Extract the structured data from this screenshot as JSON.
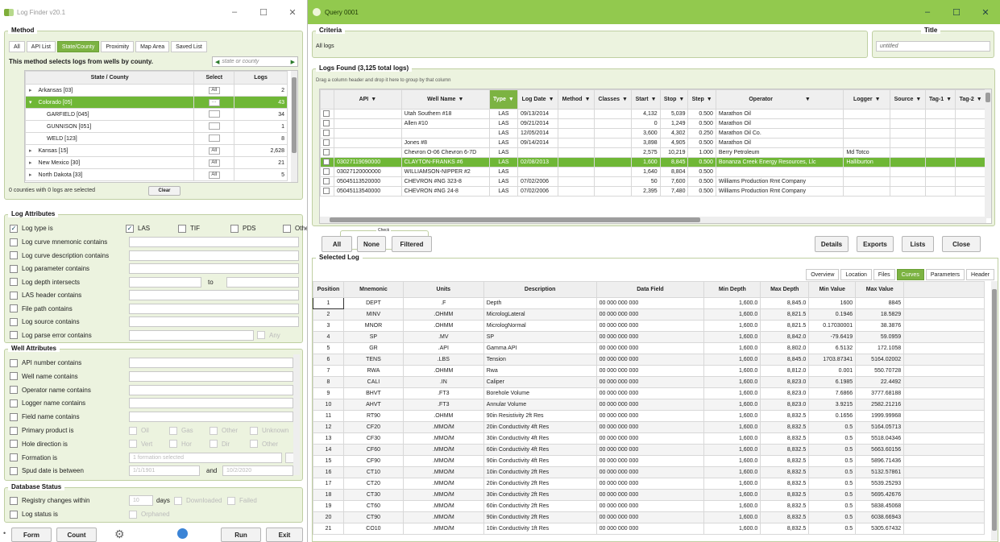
{
  "left": {
    "title": "Log Finder v20.1",
    "method": {
      "header": "Method",
      "tabs": [
        "All",
        "API List",
        "State/County",
        "Proximity",
        "Map Area",
        "Saved List"
      ],
      "desc": "This method selects logs from wells by county.",
      "search_placeholder": "state or county",
      "cols": [
        "State / County",
        "Select",
        "Logs"
      ],
      "rows": [
        {
          "name": "Arkansas  [03]",
          "sel": "All",
          "logs": "2",
          "arrow": "▸"
        },
        {
          "name": "Colorado  [05]",
          "sel": "···",
          "logs": "43",
          "arrow": "▾"
        },
        {
          "name": "GARFIELD  [045]",
          "sel": "",
          "logs": "34",
          "arrow": ""
        },
        {
          "name": "GUNNISON  [051]",
          "sel": "",
          "logs": "1",
          "arrow": ""
        },
        {
          "name": "WELD  [123]",
          "sel": "",
          "logs": "8",
          "arrow": ""
        },
        {
          "name": "Kansas  [15]",
          "sel": "All",
          "logs": "2,628",
          "arrow": "▸"
        },
        {
          "name": "New Mexico  [30]",
          "sel": "All",
          "logs": "21",
          "arrow": "▸"
        },
        {
          "name": "North Dakota  [33]",
          "sel": "All",
          "logs": "5",
          "arrow": "▸"
        }
      ],
      "status": "0 counties with 0 logs are selected",
      "clear": "Clear"
    },
    "logattr": {
      "header": "Log Attributes",
      "type_label": "Log type is",
      "types": [
        "LAS",
        "TIF",
        "PDS",
        "Other"
      ],
      "rows": [
        "Log curve mnemonic contains",
        "Log curve description contains",
        "Log parameter contains",
        "Log depth intersects",
        "LAS header contains",
        "File path contains",
        "Log source contains",
        "Log parse error contains"
      ],
      "to": "to",
      "any": "Any"
    },
    "wellattr": {
      "header": "Well Attributes",
      "rows": [
        "API number contains",
        "Well name contains",
        "Operator name contains",
        "Logger name contains",
        "Field name contains",
        "Primary product is",
        "Hole direction is",
        "Formation is",
        "Spud date is between"
      ],
      "product": [
        "Oil",
        "Gas",
        "Other",
        "Unknown"
      ],
      "direction": [
        "Vert",
        "Hor",
        "Dir",
        "Other"
      ],
      "formation": "1 formation selected",
      "date1": "1/1/1901",
      "and": "and",
      "date2": "10/2/2020"
    },
    "db": {
      "header": "Database Status",
      "rows": [
        "Registry changes within",
        "Log status is"
      ],
      "days_val": "10",
      "days": "days",
      "opt1": "Downloaded",
      "opt2": "Failed",
      "opt3": "Orphaned"
    },
    "footer": {
      "form": "Form",
      "count": "Count",
      "run": "Run",
      "exit": "Exit"
    }
  },
  "right": {
    "title": "Query 0001",
    "criteria_h": "Criteria",
    "criteria": "All logs",
    "title_h": "Title",
    "title_val": "untitled",
    "logs_h": "Logs Found  (3,125 total logs)",
    "drag": "Drag a column header and drop it here to group by that column",
    "cols": [
      "",
      "API",
      "Well Name",
      "Type",
      "Log Date",
      "Method",
      "Classes",
      "Start",
      "Stop",
      "Step",
      "Operator",
      "Logger",
      "Source",
      "Tag-1",
      "Tag-2"
    ],
    "rows": [
      [
        "",
        "",
        "Utah Southern #18",
        "LAS",
        "09/13/2014",
        "",
        "",
        "4,132",
        "5,039",
        "0.500",
        "Marathon Oil",
        "",
        "",
        "",
        ""
      ],
      [
        "",
        "",
        "Allen #10",
        "LAS",
        "09/21/2014",
        "",
        "",
        "0",
        "1,249",
        "0.500",
        "Marathon Oil",
        "",
        "",
        "",
        ""
      ],
      [
        "",
        "",
        "",
        "LAS",
        "12/05/2014",
        "",
        "",
        "3,600",
        "4,302",
        "0.250",
        "Marathon Oil Co.",
        "",
        "",
        "",
        ""
      ],
      [
        "",
        "",
        "Jones #8",
        "LAS",
        "09/14/2014",
        "",
        "",
        "3,898",
        "4,905",
        "0.500",
        "Marathon Oil",
        "",
        "",
        "",
        ""
      ],
      [
        "",
        "",
        "Chevron O-06 Chevron 6-7D",
        "LAS",
        "",
        "",
        "",
        "2,575",
        "10,219",
        "1.000",
        "Berry Petroleum",
        "Md Totco",
        "",
        "",
        ""
      ],
      [
        "",
        "03027119090000",
        "CLAYTON-FRANKS #6",
        "LAS",
        "02/08/2013",
        "",
        "",
        "1,600",
        "8,845",
        "0.500",
        "Bonanza Creek Energy Resources, Llc",
        "Halliburton",
        "",
        "",
        ""
      ],
      [
        "",
        "03027120000000",
        "WILLIAMSON-NIPPER #2",
        "LAS",
        "",
        "",
        "",
        "1,640",
        "8,804",
        "0.500",
        "",
        "",
        "",
        "",
        ""
      ],
      [
        "",
        "05045113520000",
        "CHEVRON #NG 323-8",
        "LAS",
        "07/02/2006",
        "",
        "",
        "50",
        "7,600",
        "0.500",
        "Williams Production Rmt Company",
        "",
        "",
        "",
        ""
      ],
      [
        "",
        "05045113540000",
        "CHEVRON #NG 24-8",
        "LAS",
        "07/02/2006",
        "",
        "",
        "2,395",
        "7,480",
        "0.500",
        "Williams Production Rmt Company",
        "",
        "",
        "",
        ""
      ]
    ],
    "sel_row": 5,
    "check_h": "Check",
    "b_all": "All",
    "b_none": "None",
    "b_filtered": "Filtered",
    "b_details": "Details",
    "b_exports": "Exports",
    "b_lists": "Lists",
    "b_close": "Close",
    "sel_h": "Selected Log",
    "tabs": [
      "Overview",
      "Location",
      "Files",
      "Curves",
      "Parameters",
      "Header"
    ],
    "ccols": [
      "Position",
      "Mnemonic",
      "Units",
      "Description",
      "Data Field",
      "Min Depth",
      "Max Depth",
      "Min Value",
      "Max Value"
    ],
    "curves": [
      [
        "1",
        "DEPT",
        ".F",
        "Depth",
        "00 000 000 000",
        "1,600.0",
        "8,845.0",
        "1600",
        "8845"
      ],
      [
        "2",
        "MINV",
        ".OHMM",
        "MicrologLateral",
        "00 000 000 000",
        "1,600.0",
        "8,821.5",
        "0.1946",
        "18.5829"
      ],
      [
        "3",
        "MNOR",
        ".OHMM",
        "MicrologNormal",
        "00 000 000 000",
        "1,600.0",
        "8,821.5",
        "0.17030001",
        "38.3876"
      ],
      [
        "4",
        "SP",
        ".MV",
        "SP",
        "00 000 000 000",
        "1,600.0",
        "8,842.0",
        "-79.6419",
        "59.0959"
      ],
      [
        "5",
        "GR",
        ".API",
        "Gamma API",
        "00 000 000 000",
        "1,600.0",
        "8,802.0",
        "6.5132",
        "172.1058"
      ],
      [
        "6",
        "TENS",
        ".LBS",
        "Tension",
        "00 000 000 000",
        "1,600.0",
        "8,845.0",
        "1703.87341",
        "5164.02002"
      ],
      [
        "7",
        "RWA",
        ".OHMM",
        "Rwa",
        "00 000 000 000",
        "1,600.0",
        "8,812.0",
        "0.001",
        "550.70728"
      ],
      [
        "8",
        "CALI",
        ".IN",
        "Caliper",
        "00 000 000 000",
        "1,600.0",
        "8,823.0",
        "6.1985",
        "22.4492"
      ],
      [
        "9",
        "BHVT",
        ".FT3",
        "Borehole Volume",
        "00 000 000 000",
        "1,600.0",
        "8,823.0",
        "7.6866",
        "3777.68188"
      ],
      [
        "10",
        "AHVT",
        ".FT3",
        "Annular Volume",
        "00 000 000 000",
        "1,600.0",
        "8,823.0",
        "3.9215",
        "2582.21216"
      ],
      [
        "11",
        "RT90",
        ".OHMM",
        "90in Resistivity 2ft Res",
        "00 000 000 000",
        "1,600.0",
        "8,832.5",
        "0.1656",
        "1999.99968"
      ],
      [
        "12",
        "CF20",
        ".MMO/M",
        "20in Conductivity 4ft Res",
        "00 000 000 000",
        "1,600.0",
        "8,832.5",
        "0.5",
        "5164.05713"
      ],
      [
        "13",
        "CF30",
        ".MMO/M",
        "30in Conductivity 4ft Res",
        "00 000 000 000",
        "1,600.0",
        "8,832.5",
        "0.5",
        "5518.04346"
      ],
      [
        "14",
        "CF60",
        ".MMO/M",
        "60in Conductivity 4ft Res",
        "00 000 000 000",
        "1,600.0",
        "8,832.5",
        "0.5",
        "5663.60156"
      ],
      [
        "15",
        "CF90",
        ".MMO/M",
        "90in Conductivity 4ft Res",
        "00 000 000 000",
        "1,600.0",
        "8,832.5",
        "0.5",
        "5896.71436"
      ],
      [
        "16",
        "CT10",
        ".MMO/M",
        "10in Conductivity 2ft Res",
        "00 000 000 000",
        "1,600.0",
        "8,832.5",
        "0.5",
        "5132.57861"
      ],
      [
        "17",
        "CT20",
        ".MMO/M",
        "20in Conductivity 2ft Res",
        "00 000 000 000",
        "1,600.0",
        "8,832.5",
        "0.5",
        "5539.25293"
      ],
      [
        "18",
        "CT30",
        ".MMO/M",
        "30in Conductivity 2ft Res",
        "00 000 000 000",
        "1,600.0",
        "8,832.5",
        "0.5",
        "5695.42676"
      ],
      [
        "19",
        "CT60",
        ".MMO/M",
        "60in Conductivity 2ft Res",
        "00 000 000 000",
        "1,600.0",
        "8,832.5",
        "0.5",
        "5838.45068"
      ],
      [
        "20",
        "CT90",
        ".MMO/M",
        "90in Conductivity 2ft Res",
        "00 000 000 000",
        "1,600.0",
        "8,832.5",
        "0.5",
        "6038.66943"
      ],
      [
        "21",
        "CO10",
        ".MMO/M",
        "10in Conductivity 1ft Res",
        "00 000 000 000",
        "1,600.0",
        "8,832.5",
        "0.5",
        "5305.67432"
      ]
    ]
  }
}
